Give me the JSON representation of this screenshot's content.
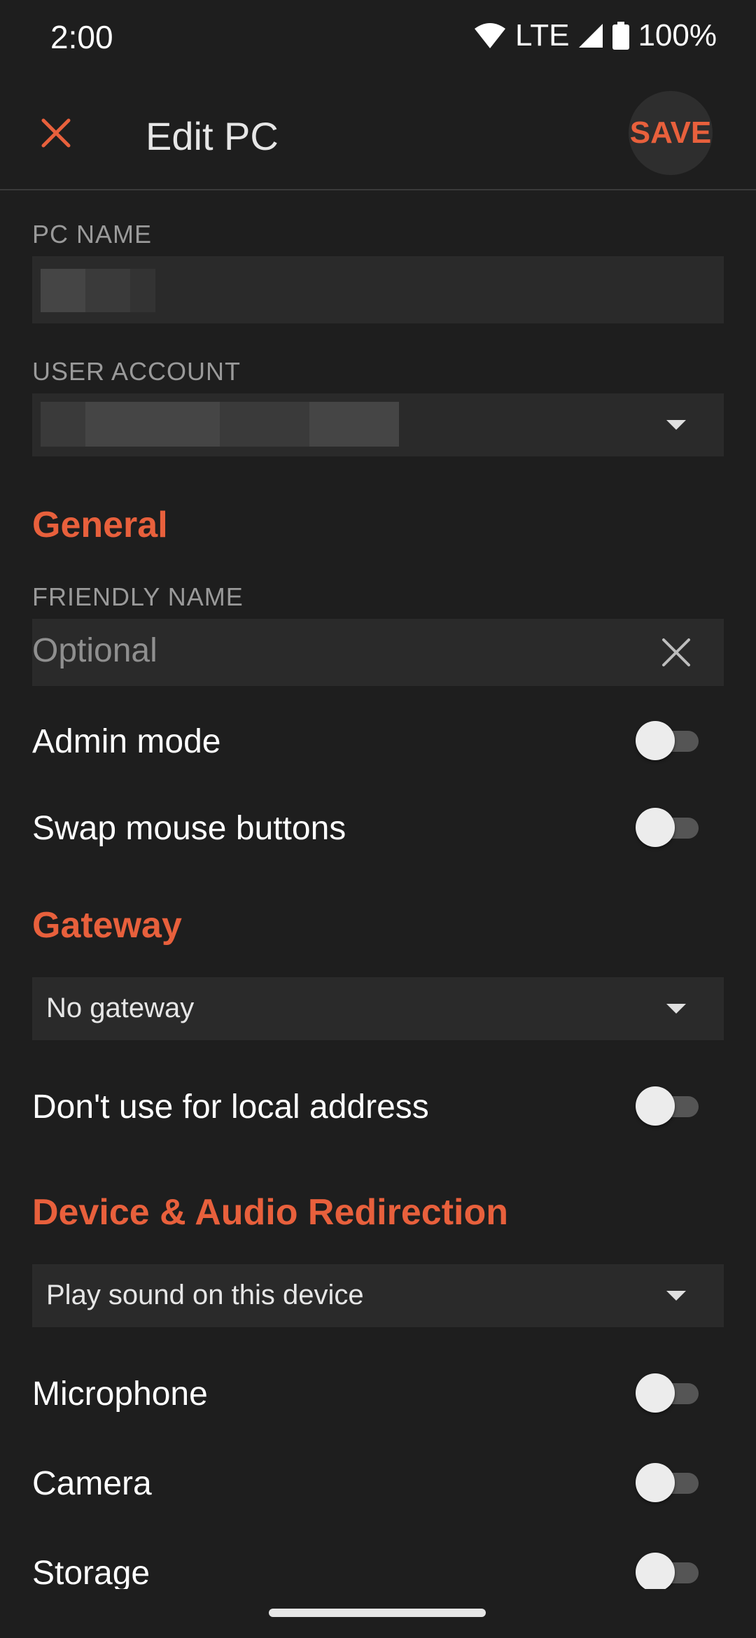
{
  "status_bar": {
    "time": "2:00",
    "network": "LTE",
    "battery": "100%"
  },
  "app_bar": {
    "title": "Edit PC",
    "save_label": "SAVE"
  },
  "form": {
    "pc_name_label": "PC NAME",
    "user_account_label": "USER ACCOUNT"
  },
  "general": {
    "heading": "General",
    "friendly_name_label": "FRIENDLY NAME",
    "friendly_name_placeholder": "Optional",
    "friendly_name_value": "",
    "admin_mode_label": "Admin mode",
    "admin_mode_on": false,
    "swap_mouse_label": "Swap mouse buttons",
    "swap_mouse_on": false
  },
  "gateway": {
    "heading": "Gateway",
    "selected": "No gateway",
    "local_address_label": "Don't use for local address",
    "local_address_on": false
  },
  "redirection": {
    "heading": "Device & Audio Redirection",
    "sound_selected": "Play sound on this device",
    "microphone_label": "Microphone",
    "microphone_on": false,
    "camera_label": "Camera",
    "camera_on": false,
    "storage_label": "Storage",
    "storage_on": false
  },
  "colors": {
    "accent": "#e8603c",
    "background": "#1e1e1e",
    "field": "#2a2a2a"
  },
  "icons": {
    "close": "close-icon",
    "clear": "clear-icon",
    "dropdown": "chevron-down-icon"
  }
}
